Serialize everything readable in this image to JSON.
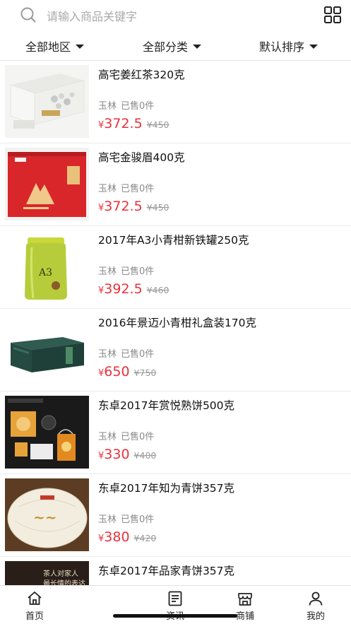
{
  "search": {
    "placeholder": "请输入商品关键字"
  },
  "filters": [
    {
      "label": "全部地区"
    },
    {
      "label": "全部分类"
    },
    {
      "label": "默认排序"
    }
  ],
  "products": [
    {
      "title": "高宅姜红茶320克",
      "location": "玉林",
      "sold": "已售0件",
      "currency": "¥",
      "price": "372.5",
      "old_price": "¥450",
      "thumb_icon": "white-tea-gift-box-image"
    },
    {
      "title": "高宅金骏眉400克",
      "location": "玉林",
      "sold": "已售0件",
      "currency": "¥",
      "price": "372.5",
      "old_price": "¥450",
      "thumb_icon": "red-tea-gift-box-image"
    },
    {
      "title": "2017年A3小青柑新铁罐250克",
      "location": "玉林",
      "sold": "已售0件",
      "currency": "¥",
      "price": "392.5",
      "old_price": "¥460",
      "thumb_icon": "green-tea-tin-image"
    },
    {
      "title": "2016年景迈小青柑礼盒装170克",
      "location": "玉林",
      "sold": "已售0件",
      "currency": "¥",
      "price": "650",
      "old_price": "¥750",
      "thumb_icon": "green-gift-box-image"
    },
    {
      "title": "东卓2017年赏悦熟饼500克",
      "location": "玉林",
      "sold": "已售0件",
      "currency": "¥",
      "price": "330",
      "old_price": "¥400",
      "thumb_icon": "tea-cake-set-image"
    },
    {
      "title": "东卓2017年知为青饼357克",
      "location": "玉林",
      "sold": "已售0件",
      "currency": "¥",
      "price": "380",
      "old_price": "¥420",
      "thumb_icon": "wrapped-tea-cake-image"
    },
    {
      "title": "东卓2017年品家青饼357克",
      "location": "玉林",
      "sold": "已售0件",
      "currency": "¥",
      "price": "",
      "old_price": "",
      "thumb_icon": "tea-banner-image",
      "thumb_text_1": "茶人对家人",
      "thumb_text_2": "最长情的表达"
    }
  ],
  "tabbar": [
    {
      "label": "首页",
      "icon": "home-icon"
    },
    {
      "label": "资讯",
      "icon": "news-icon"
    },
    {
      "label": "商铺",
      "icon": "shop-icon"
    },
    {
      "label": "我的",
      "icon": "user-icon"
    }
  ],
  "colors": {
    "price": "#e8323c",
    "old_price": "#9a9a9a",
    "meta": "#8a8a8a"
  }
}
